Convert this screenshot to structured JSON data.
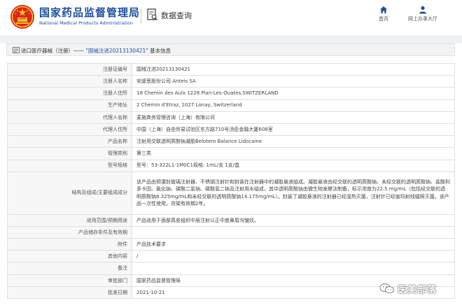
{
  "header": {
    "agency_cn": "国家药品监督管理局",
    "agency_en": "National Medical Products Administration",
    "section_title": "数据查询",
    "nav": [
      {
        "label": "首页",
        "icon": "home-icon"
      },
      {
        "label": "网上办事大厅",
        "icon": "user-icon"
      }
    ]
  },
  "breadcrumb": {
    "prefix": "进口医疗器械（注册）——",
    "highlight": "\"国械注进20213130421\"",
    "suffix": "基本信息"
  },
  "details": [
    {
      "label": "注册证编号",
      "value": "国械注进20213130421"
    },
    {
      "label": "注册人名称",
      "value": "安缇思股份公司 Anteis SA"
    },
    {
      "label": "注册人住所",
      "value": "18 Chemin des Aulx 1228 Plan-Les-Ouates,SWITZERLAND"
    },
    {
      "label": "生产地址",
      "value": "2 Chemin d'Etraz, 1027 Lonay, Switzerland"
    },
    {
      "label": "代理人名称",
      "value": "麦施商务管理咨询（上海）有限公司"
    },
    {
      "label": "代理人住所",
      "value": "中国（上海）自由贸易试验区东方路710号汤臣金融大厦608室"
    },
    {
      "label": "产品名称",
      "value": "注射用交联透明质酸钠凝胶Belotero Balance Lidocaine"
    },
    {
      "label": "管理类别",
      "value": "第三类"
    },
    {
      "label": "型号规格",
      "value": "型号：53-322L1-1M0C1规格: 1mL/支 1支/盒"
    },
    {
      "label": "结构及组成/主要组成成分",
      "value": "该产品由预灌封玻璃注射器、不锈钢注射针和封装在注射器中的凝胶悬液组成。凝胶悬液由经交联的透明质酸钠、未经交联的透明质酸钠、盐酸利多卡因、氯化钠、磷酸二氢钠、磷酸氢二钠及注射用水组成，其中透明质酸钠由微生物发酵法制备，标示浓度为22.5 mg/mL（包括经交联的透明质酸钠8.325mg/mL和未经交联的透明质酸钠14.175mg/mL）。封装了凝胶悬液的注射器已经湿热灭菌，注射针已经伽玛射线辐照灭菌。该产品一次性使用，货架有效期2年。"
    },
    {
      "label": "适用范围/预期用途",
      "value": "产品适用于面部真皮组织中层注射以正中度鼻唇沟皱纹。"
    },
    {
      "label": "产品储存条件及有效期",
      "value": ""
    },
    {
      "label": "附件",
      "value": "产品技术要求"
    },
    {
      "label": "其他内容",
      "value": "/"
    },
    {
      "label": "备注",
      "value": ""
    },
    {
      "label": "审批部门",
      "value": "国家药品监督管理局"
    },
    {
      "label": "批准日期",
      "value": "2021-10-21"
    }
  ],
  "watermark": {
    "text": "医美部落",
    "icon": "wechat-icon"
  },
  "colors": {
    "brand_blue": "#1e4f9c",
    "emblem_red": "#d7261b",
    "emblem_gold": "#f2c12e",
    "label_bg": "#f7f7f7"
  }
}
